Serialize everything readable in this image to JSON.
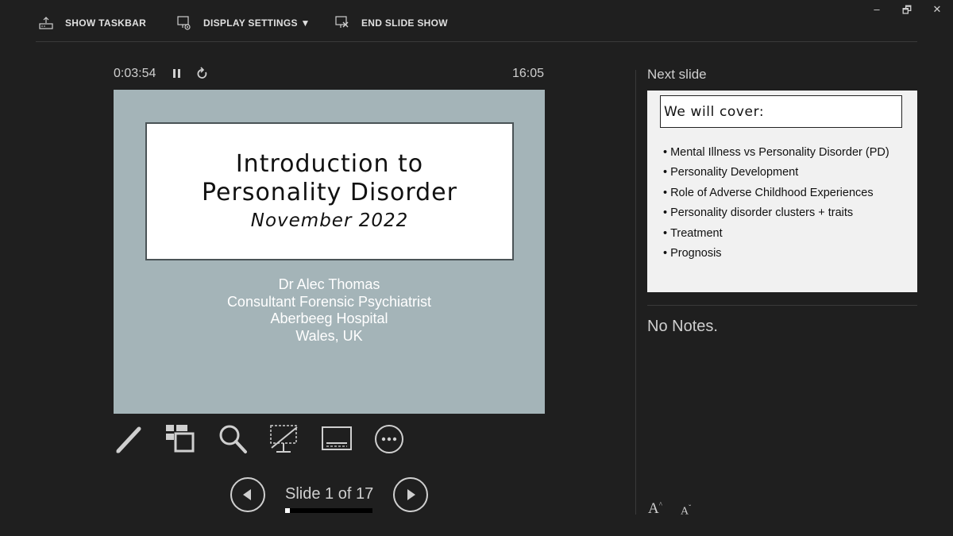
{
  "toolbar": {
    "show_taskbar": "SHOW TASKBAR",
    "display_settings": "DISPLAY SETTINGS ▼",
    "end_slide_show": "END SLIDE SHOW"
  },
  "window_controls": {
    "minimize": "–",
    "restore": "🗗",
    "close": "✕"
  },
  "timer": {
    "elapsed": "0:03:54",
    "clock": "16:05"
  },
  "current_slide": {
    "title_line1": "Introduction to",
    "title_line2": "Personality Disorder",
    "date": "November 2022",
    "author": [
      "Dr Alec Thomas",
      "Consultant Forensic Psychiatrist",
      "Aberbeeg Hospital",
      "Wales, UK"
    ]
  },
  "tools": [
    "pen-tool-icon",
    "see-all-slides-icon",
    "zoom-icon",
    "black-screen-icon",
    "subtitles-icon",
    "more-options-icon"
  ],
  "navigation": {
    "slide_label": "Slide 1 of 17",
    "progress_fraction": 0.0588
  },
  "next_slide": {
    "label": "Next slide",
    "heading": "We will cover:",
    "bullets": [
      "Mental Illness vs Personality Disorder (PD)",
      "Personality Development",
      "Role of Adverse Childhood Experiences",
      "Personality disorder clusters + traits",
      "Treatment",
      "Prognosis"
    ]
  },
  "notes": {
    "text": "No Notes."
  },
  "font_controls": {
    "increase": "A",
    "decrease": "A"
  },
  "colors": {
    "slide_background": "#a4b4b8",
    "app_background": "#1f1f1f"
  }
}
